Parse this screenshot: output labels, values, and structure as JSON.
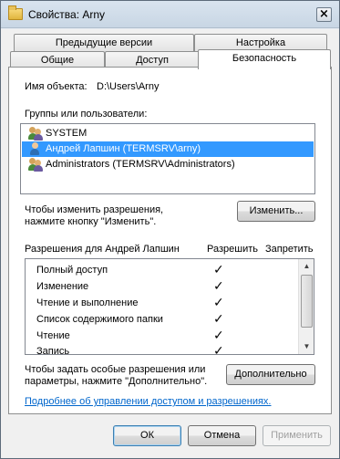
{
  "window": {
    "title": "Свойства: Arny"
  },
  "tabs": {
    "row1": [
      "Предыдущие версии",
      "Настройка"
    ],
    "row2": [
      "Общие",
      "Доступ",
      "Безопасность"
    ]
  },
  "object": {
    "label": "Имя объекта:",
    "value": "D:\\Users\\Arny"
  },
  "groups": {
    "label": "Группы или пользователи:",
    "items": [
      {
        "name": "SYSTEM",
        "selected": false
      },
      {
        "name": "Андрей Лапшин (TERMSRV\\arny)",
        "selected": true
      },
      {
        "name": "Administrators (TERMSRV\\Administrators)",
        "selected": false
      }
    ]
  },
  "change": {
    "text_line1": "Чтобы изменить разрешения,",
    "text_line2": "нажмите кнопку \"Изменить\".",
    "button": "Изменить..."
  },
  "permissions": {
    "header": "Разрешения для Андрей Лапшин",
    "allow_header": "Разрешить",
    "deny_header": "Запретить",
    "items": [
      {
        "name": "Полный доступ",
        "allow": "✓"
      },
      {
        "name": "Изменение",
        "allow": "✓"
      },
      {
        "name": "Чтение и выполнение",
        "allow": "✓"
      },
      {
        "name": "Список содержимого папки",
        "allow": "✓"
      },
      {
        "name": "Чтение",
        "allow": "✓"
      },
      {
        "name": "Запись",
        "allow": "✓"
      }
    ]
  },
  "advanced": {
    "text_line1": "Чтобы задать особые разрешения или",
    "text_line2": "параметры, нажмите \"Дополнительно\".",
    "button": "Дополнительно"
  },
  "link": "Подробнее об управлении доступом и разрешениях.",
  "footer": {
    "ok": "ОК",
    "cancel": "Отмена",
    "apply": "Применить"
  },
  "colors": {
    "selection": "#3399ff",
    "link": "#0066cc"
  }
}
